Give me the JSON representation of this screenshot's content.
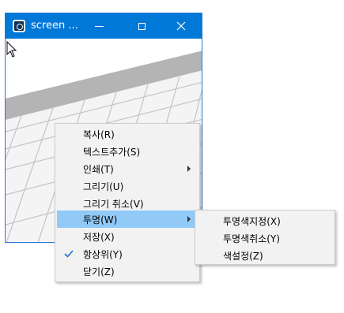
{
  "window": {
    "title": "screen ...",
    "accent_color": "#0078d7",
    "minimize_icon": "minimize-icon",
    "maximize_icon": "maximize-icon",
    "close_icon": "close-icon"
  },
  "context_menu": {
    "items": [
      {
        "label": "복사(R)"
      },
      {
        "label": "텍스트추가(S)"
      },
      {
        "label": "인쇄(T)",
        "has_submenu": true
      },
      {
        "label": "그리기(U)"
      },
      {
        "label": "그리기 취소(V)"
      },
      {
        "label": "투명(W)",
        "has_submenu": true,
        "highlighted": true
      },
      {
        "label": "저장(X)"
      },
      {
        "label": "항상위(Y)",
        "checked": true
      },
      {
        "label": "닫기(Z)"
      }
    ],
    "highlight_color": "#91c9f7"
  },
  "submenu": {
    "items": [
      {
        "label": "투명색지정(X)"
      },
      {
        "label": "투명색취소(Y)"
      },
      {
        "label": "색설정(Z)"
      }
    ]
  }
}
